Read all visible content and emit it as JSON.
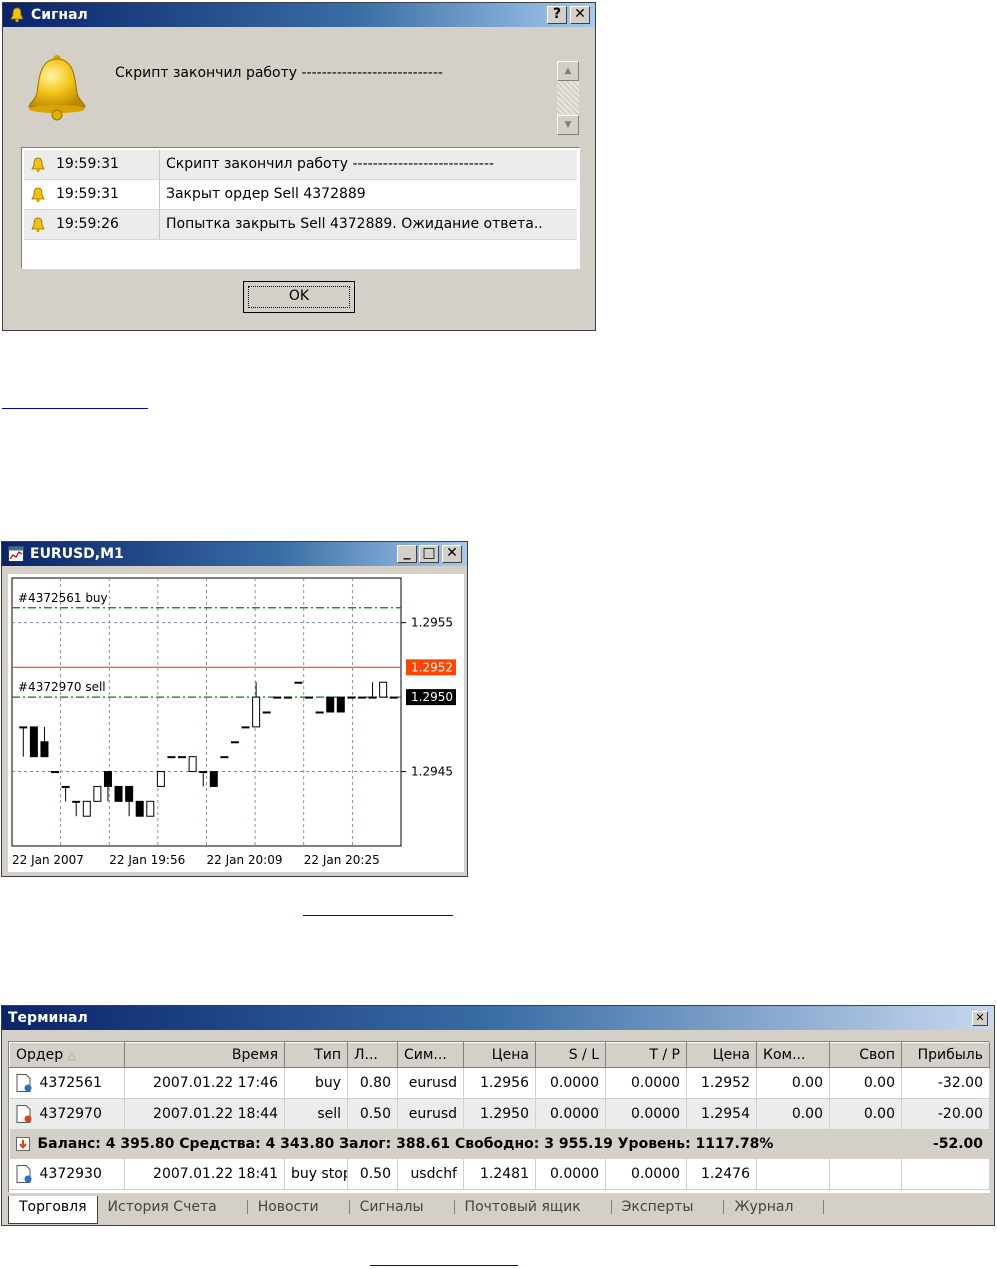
{
  "alert_dialog": {
    "title": "Сигнал",
    "help_button": "?",
    "close_button": "✕",
    "message": "Скрипт закончил работу ----------------------------",
    "log": [
      {
        "time": "19:59:31",
        "text": "Скрипт закончил работу ----------------------------"
      },
      {
        "time": "19:59:31",
        "text": "Закрыт ордер Sell  4372889"
      },
      {
        "time": "19:59:26",
        "text": "Попытка закрыть Sell  4372889. Ожидание ответа.."
      }
    ],
    "ok_label": "OK"
  },
  "chart_window": {
    "title": "EURUSD,M1",
    "min_button": "_",
    "max_button": "□",
    "close_button": "✕"
  },
  "chart_data": {
    "type": "candlestick",
    "symbol": "EURUSD",
    "timeframe": "M1",
    "ylim": [
      1.294,
      1.2958
    ],
    "y_ticks": [
      "1.2955",
      "1.2945"
    ],
    "x_ticks": [
      "22 Jan 2007",
      "22 Jan 19:56",
      "22 Jan 20:09",
      "22 Jan 20:25"
    ],
    "lines": [
      {
        "label": "#4372561 buy",
        "price": 1.2956,
        "color": "#008000",
        "style": "dash-dot"
      },
      {
        "label": "#4372970 sell",
        "price": 1.295,
        "color": "#008000",
        "style": "dash-dot"
      },
      {
        "label": "",
        "price": 1.2952,
        "color": "#ff4500",
        "style": "solid"
      }
    ],
    "current_price_labels": [
      {
        "text": "1.2952",
        "price": 1.2952,
        "bg": "#ff4500"
      },
      {
        "text": "1.2950",
        "price": 1.295,
        "bg": "#000000"
      }
    ],
    "candles": [
      {
        "o": 1.2948,
        "h": 1.2948,
        "l": 1.2946,
        "c": 1.2948
      },
      {
        "o": 1.2948,
        "h": 1.2948,
        "l": 1.2946,
        "c": 1.2946
      },
      {
        "o": 1.2947,
        "h": 1.2948,
        "l": 1.2946,
        "c": 1.2946
      },
      {
        "o": 1.2945,
        "h": 1.2945,
        "l": 1.2945,
        "c": 1.2945
      },
      {
        "o": 1.2944,
        "h": 1.2944,
        "l": 1.2943,
        "c": 1.2944
      },
      {
        "o": 1.2943,
        "h": 1.2943,
        "l": 1.2942,
        "c": 1.2943
      },
      {
        "o": 1.2942,
        "h": 1.2943,
        "l": 1.2942,
        "c": 1.2943
      },
      {
        "o": 1.2943,
        "h": 1.2944,
        "l": 1.2943,
        "c": 1.2944
      },
      {
        "o": 1.2945,
        "h": 1.2945,
        "l": 1.2943,
        "c": 1.2944
      },
      {
        "o": 1.2944,
        "h": 1.2944,
        "l": 1.2943,
        "c": 1.2943
      },
      {
        "o": 1.2944,
        "h": 1.2944,
        "l": 1.2942,
        "c": 1.2943
      },
      {
        "o": 1.2943,
        "h": 1.2943,
        "l": 1.2942,
        "c": 1.2942
      },
      {
        "o": 1.2942,
        "h": 1.2943,
        "l": 1.2942,
        "c": 1.2943
      },
      {
        "o": 1.2944,
        "h": 1.2945,
        "l": 1.2944,
        "c": 1.2945
      },
      {
        "o": 1.2946,
        "h": 1.2946,
        "l": 1.2946,
        "c": 1.2946
      },
      {
        "o": 1.2946,
        "h": 1.2946,
        "l": 1.2946,
        "c": 1.2946
      },
      {
        "o": 1.2945,
        "h": 1.2946,
        "l": 1.2945,
        "c": 1.2946
      },
      {
        "o": 1.2945,
        "h": 1.2945,
        "l": 1.2944,
        "c": 1.2945
      },
      {
        "o": 1.2945,
        "h": 1.2945,
        "l": 1.2944,
        "c": 1.2944
      },
      {
        "o": 1.2946,
        "h": 1.2946,
        "l": 1.2946,
        "c": 1.2946
      },
      {
        "o": 1.2947,
        "h": 1.2947,
        "l": 1.2947,
        "c": 1.2947
      },
      {
        "o": 1.2948,
        "h": 1.2948,
        "l": 1.2948,
        "c": 1.2948
      },
      {
        "o": 1.2948,
        "h": 1.2951,
        "l": 1.2948,
        "c": 1.295
      },
      {
        "o": 1.2949,
        "h": 1.2949,
        "l": 1.2949,
        "c": 1.2949
      },
      {
        "o": 1.295,
        "h": 1.295,
        "l": 1.295,
        "c": 1.295
      },
      {
        "o": 1.295,
        "h": 1.295,
        "l": 1.295,
        "c": 1.295
      },
      {
        "o": 1.2951,
        "h": 1.2951,
        "l": 1.2951,
        "c": 1.2951
      },
      {
        "o": 1.295,
        "h": 1.295,
        "l": 1.295,
        "c": 1.295
      },
      {
        "o": 1.2949,
        "h": 1.2949,
        "l": 1.2949,
        "c": 1.2949
      },
      {
        "o": 1.295,
        "h": 1.295,
        "l": 1.2949,
        "c": 1.2949
      },
      {
        "o": 1.295,
        "h": 1.295,
        "l": 1.2949,
        "c": 1.2949
      },
      {
        "o": 1.295,
        "h": 1.295,
        "l": 1.295,
        "c": 1.295
      },
      {
        "o": 1.295,
        "h": 1.295,
        "l": 1.295,
        "c": 1.295
      },
      {
        "o": 1.295,
        "h": 1.2951,
        "l": 1.295,
        "c": 1.295
      },
      {
        "o": 1.295,
        "h": 1.2951,
        "l": 1.295,
        "c": 1.2951
      },
      {
        "o": 1.295,
        "h": 1.295,
        "l": 1.295,
        "c": 1.295
      }
    ],
    "grid": true
  },
  "terminal": {
    "title": "Терминал",
    "close_button": "✕",
    "columns": [
      "Ордер",
      "Время",
      "Тип",
      "Л...",
      "Сим...",
      "Цена",
      "S / L",
      "T / P",
      "Цена",
      "Ком...",
      "Своп",
      "Прибыль"
    ],
    "orders": [
      {
        "order": "4372561",
        "time": "2007.01.22 17:46",
        "type": "buy",
        "lots": "0.80",
        "symbol": "eurusd",
        "price": "1.2956",
        "sl": "0.0000",
        "tp": "0.0000",
        "cur": "1.2952",
        "comm": "0.00",
        "swap": "0.00",
        "profit": "-32.00",
        "icon": "blue"
      },
      {
        "order": "4372970",
        "time": "2007.01.22 18:44",
        "type": "sell",
        "lots": "0.50",
        "symbol": "eurusd",
        "price": "1.2950",
        "sl": "0.0000",
        "tp": "0.0000",
        "cur": "1.2954",
        "comm": "0.00",
        "swap": "0.00",
        "profit": "-20.00",
        "icon": "red"
      }
    ],
    "balance_line": "Баланс: 4 395.80  Средства: 4 343.80  Залог: 388.61  Свободно: 3 955.19  Уровень: 1117.78%",
    "balance_profit": "-52.00",
    "pending": {
      "order": "4372930",
      "time": "2007.01.22 18:41",
      "type": "buy stop",
      "lots": "0.50",
      "symbol": "usdchf",
      "price": "1.2481",
      "sl": "0.0000",
      "tp": "0.0000",
      "cur": "1.2476",
      "icon": "blue"
    },
    "tabs": [
      "Торговля",
      "История Счета",
      "Новости",
      "Сигналы",
      "Почтовый ящик",
      "Эксперты",
      "Журнал"
    ]
  }
}
